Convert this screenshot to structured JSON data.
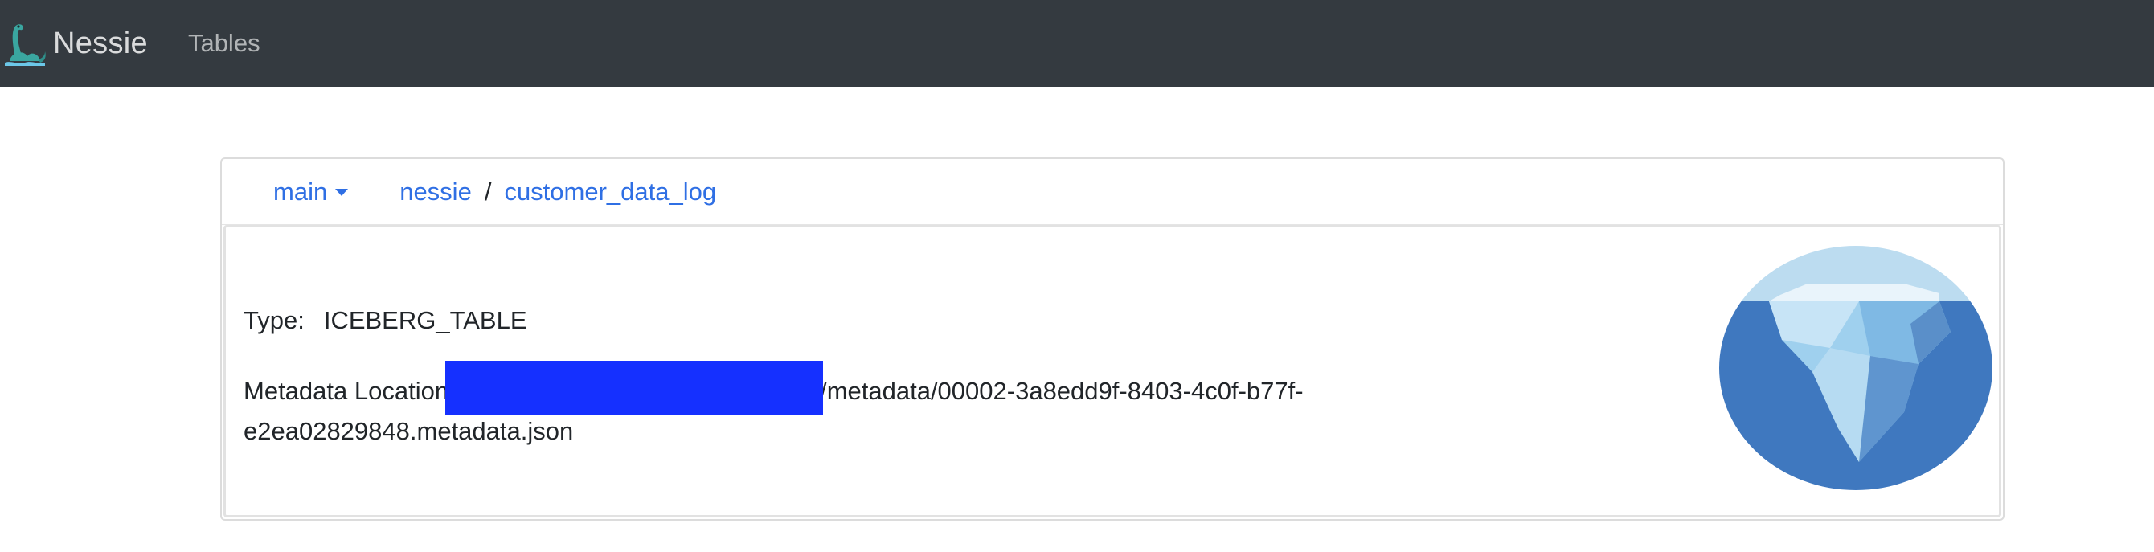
{
  "navbar": {
    "brand": "Nessie",
    "tables_link": "Tables",
    "logo_icon": "nessie-dinosaur-icon"
  },
  "header": {
    "branch": "main",
    "breadcrumb": [
      "nessie",
      "customer_data_log"
    ],
    "separator": "/"
  },
  "details": {
    "type_label": "Type:",
    "type_value": "ICEBERG_TABLE",
    "metadata_label": "Metadata Location",
    "metadata_suffix": "/metadata/00002-3a8edd9f-8403-4c0f-b77f-e2ea02829848.metadata.json",
    "redaction_color": "#1530ff"
  },
  "icons": {
    "table_type": "iceberg-icon"
  },
  "colors": {
    "navbar": "#343a40",
    "link": "#2f6fe4",
    "iceberg_water": "#3f78bf",
    "iceberg_sky": "#bcdcf0"
  }
}
